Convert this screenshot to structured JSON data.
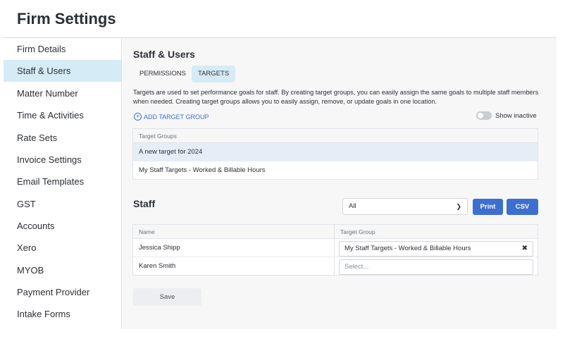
{
  "page": {
    "title": "Firm Settings"
  },
  "sidebar": {
    "items": [
      {
        "label": "Firm Details"
      },
      {
        "label": "Staff & Users"
      },
      {
        "label": "Matter Number"
      },
      {
        "label": "Time & Activities"
      },
      {
        "label": "Rate Sets"
      },
      {
        "label": "Invoice Settings"
      },
      {
        "label": "Email Templates"
      },
      {
        "label": "GST"
      },
      {
        "label": "Accounts"
      },
      {
        "label": "Xero"
      },
      {
        "label": "MYOB"
      },
      {
        "label": "Payment Provider"
      },
      {
        "label": "Intake Forms"
      }
    ],
    "active_index": 1
  },
  "section": {
    "title": "Staff & Users",
    "tabs": [
      {
        "label": "PERMISSIONS"
      },
      {
        "label": "TARGETS"
      }
    ],
    "active_tab": "TARGETS",
    "description": "Targets are used to set performance goals for staff. By creating target groups, you can easily assign the same goals to multiple staff members when needed. Creating target groups allows you to easily assign, remove, or update goals in one location.",
    "add_group_label": "ADD TARGET GROUP",
    "show_inactive_label": "Show inactive",
    "show_inactive_on": false
  },
  "target_groups": {
    "header": "Target Groups",
    "rows": [
      {
        "name": "A new target for 2024"
      },
      {
        "name": "My Staff Targets - Worked & Billable Hours"
      }
    ]
  },
  "staff": {
    "title": "Staff",
    "filter_value": "All",
    "print_label": "Print",
    "csv_label": "CSV",
    "columns": {
      "name": "Name",
      "target_group": "Target Group"
    },
    "rows": [
      {
        "name": "Jessica Shipp",
        "target_group": "My Staff Targets - Worked & Billable Hours"
      },
      {
        "name": "Karen Smith",
        "target_group_placeholder": "Select..."
      }
    ],
    "save_label": "Save"
  },
  "colors": {
    "accent": "#3d6fd1",
    "active_bg": "#d5ecf6",
    "selected_row": "#e5eef7"
  }
}
